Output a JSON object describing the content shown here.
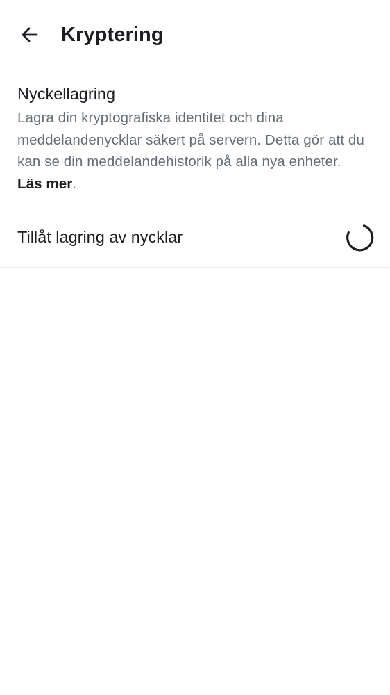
{
  "header": {
    "title": "Kryptering",
    "back_icon": "arrow-left-icon"
  },
  "key_storage": {
    "title": "Nyckellagring",
    "description": "Lagra din kryptografiska identitet och dina meddelandenycklar säkert på servern. Detta gör att du kan se din meddelandehistorik på alla nya enheter.",
    "learn_more": "Läs mer",
    "trailing_period": "."
  },
  "toggle": {
    "label": "Tillåt lagring av nycklar",
    "state_icon": "loading-spinner-icon"
  },
  "colors": {
    "text_primary": "#1b1d22",
    "text_secondary": "#656d77",
    "divider": "#e9ebee",
    "background": "#ffffff"
  }
}
